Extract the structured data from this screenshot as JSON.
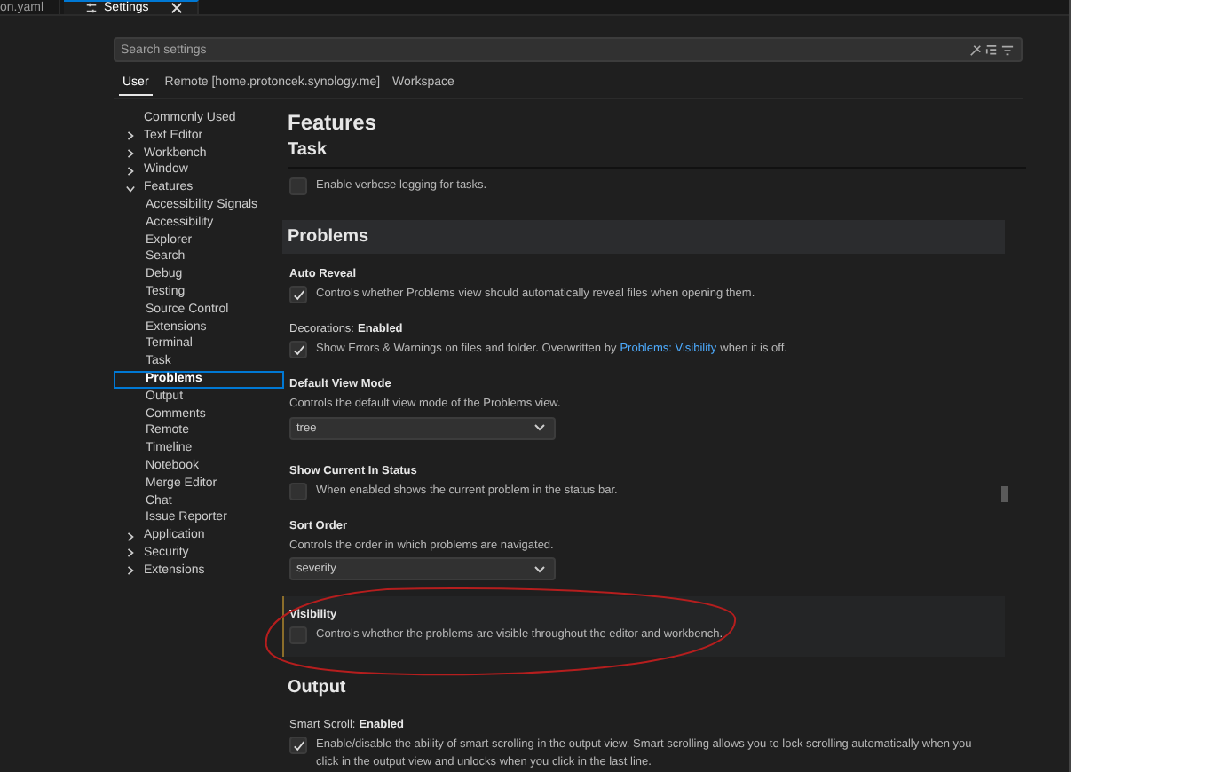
{
  "tabs": [
    {
      "label": "on.yaml",
      "selected": false,
      "closable": false
    },
    {
      "label": "Settings",
      "selected": true,
      "closable": true
    }
  ],
  "search": {
    "placeholder": "Search settings"
  },
  "scopes": [
    {
      "label": "User",
      "selected": true
    },
    {
      "label": "Remote [home.protoncek.synology.me]",
      "selected": false
    },
    {
      "label": "Workspace",
      "selected": false
    }
  ],
  "sidebar": {
    "items": [
      {
        "label": "Commonly Used",
        "selected": false
      },
      {
        "label": "Text Editor",
        "selected": false,
        "expanded": false
      },
      {
        "label": "Workbench",
        "selected": false,
        "expanded": false
      },
      {
        "label": "Window",
        "selected": false,
        "expanded": false
      },
      {
        "label": "Features",
        "selected": false,
        "expanded": true,
        "children": [
          {
            "label": "Accessibility Signals",
            "selected": false
          },
          {
            "label": "Accessibility",
            "selected": false
          },
          {
            "label": "Explorer",
            "selected": false
          },
          {
            "label": "Search",
            "selected": false
          },
          {
            "label": "Debug",
            "selected": false
          },
          {
            "label": "Testing",
            "selected": false
          },
          {
            "label": "Source Control",
            "selected": false
          },
          {
            "label": "Extensions",
            "selected": false
          },
          {
            "label": "Terminal",
            "selected": false
          },
          {
            "label": "Task",
            "selected": false
          },
          {
            "label": "Problems",
            "selected": true
          },
          {
            "label": "Output",
            "selected": false
          },
          {
            "label": "Comments",
            "selected": false
          },
          {
            "label": "Remote",
            "selected": false
          },
          {
            "label": "Timeline",
            "selected": false
          },
          {
            "label": "Notebook",
            "selected": false
          },
          {
            "label": "Merge Editor",
            "selected": false
          },
          {
            "label": "Chat",
            "selected": false
          },
          {
            "label": "Issue Reporter",
            "selected": false
          }
        ]
      },
      {
        "label": "Application",
        "selected": false,
        "expanded": false
      },
      {
        "label": "Security",
        "selected": false,
        "expanded": false
      },
      {
        "label": "Extensions",
        "selected": false,
        "expanded": false
      }
    ]
  },
  "sticky_headers": [
    "Features",
    "Task"
  ],
  "sections": [
    {
      "items": [
        {
          "kind": "checkbox",
          "description": "Enable verbose logging for tasks.",
          "checked": false,
          "focused": false
        }
      ]
    },
    {
      "title": "Problems",
      "highlighted": true,
      "items": [
        {
          "kind": "checkbox",
          "name": "Auto Reveal",
          "description": "Controls whether Problems view should automatically reveal files when opening them.",
          "checked": true,
          "focused": false
        },
        {
          "kind": "checkbox",
          "category": "Decorations:",
          "name": "Enabled",
          "description": "Show Errors & Warnings on files and folder. Overwritten by",
          "link": "Problems: Visibility",
          "description_after": "when it is off.",
          "checked": true,
          "focused": false
        },
        {
          "kind": "dropdown",
          "name": "Default View Mode",
          "description": "Controls the default view mode of the Problems view.",
          "value": "tree",
          "focused": false
        },
        {
          "kind": "checkbox",
          "name": "Show Current In Status",
          "description": "When enabled shows the current problem in the status bar.",
          "checked": false,
          "focused": false
        },
        {
          "kind": "dropdown",
          "name": "Sort Order",
          "description": "Controls the order in which problems are navigated.",
          "value": "severity",
          "focused": false
        },
        {
          "kind": "checkbox",
          "name": "Visibility",
          "description": "Controls whether the problems are visible throughout the editor and workbench.",
          "checked": false,
          "focused": true
        }
      ]
    },
    {
      "title": "Output",
      "highlighted": false,
      "items": [
        {
          "kind": "checkbox",
          "category": "Smart Scroll:",
          "name": "Enabled",
          "description": "Enable/disable the ability of smart scrolling in the output view. Smart scrolling allows you to lock scrolling automatically when you click in the output view and unlocks when you click in the last line.",
          "checked": true,
          "focused": false
        }
      ]
    }
  ]
}
